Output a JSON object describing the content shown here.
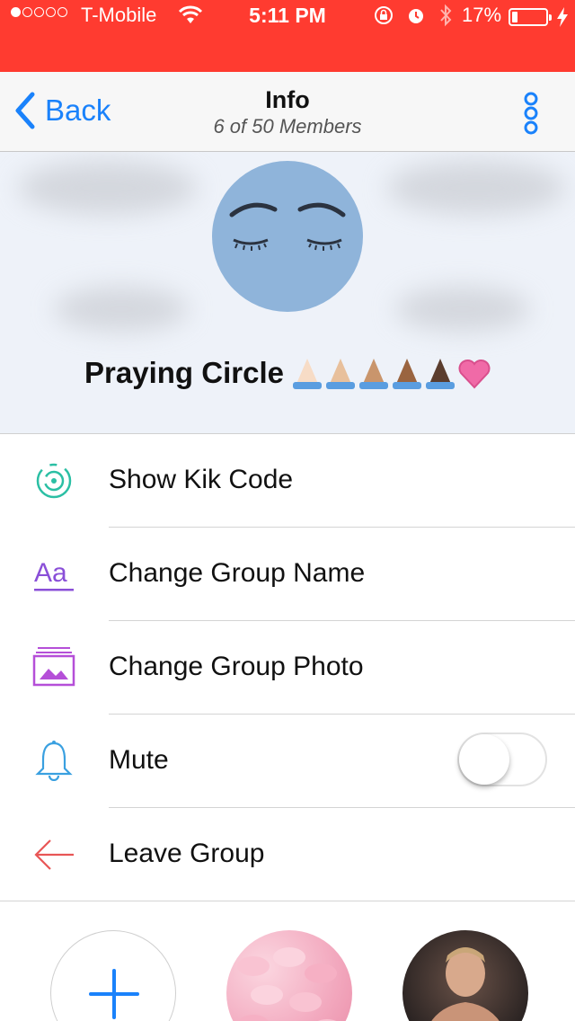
{
  "status_bar": {
    "carrier": "T-Mobile",
    "time": "5:11 PM",
    "battery": "17%",
    "battery_level": 0.17,
    "signal_bars": 1,
    "icons": [
      "wifi-icon",
      "rotation-lock-icon",
      "alarm-icon",
      "bluetooth-icon",
      "battery-icon",
      "charging-bolt-icon"
    ]
  },
  "nav": {
    "back_label": "Back",
    "title": "Info",
    "subtitle": "6 of 50 Members",
    "more_icon": "vertical-dots-icon"
  },
  "group": {
    "name": "Praying Circle",
    "emojis": [
      "🙏🏻",
      "🙏🏼",
      "🙏🏽",
      "🙏🏾",
      "🙏🏿",
      "💗"
    ]
  },
  "menu": [
    {
      "label": "Show Kik Code",
      "icon": "kik-code-icon",
      "color": "#2bbfa4"
    },
    {
      "label": "Change Group Name",
      "icon": "text-aa-icon",
      "color": "#8a4fd8"
    },
    {
      "label": "Change Group Photo",
      "icon": "photo-stack-icon",
      "color": "#b54fd8"
    },
    {
      "label": "Mute",
      "icon": "bell-icon",
      "color": "#3aa0e0",
      "toggle": false
    },
    {
      "label": "Leave Group",
      "icon": "arrow-left-icon",
      "color": "#e85656"
    }
  ],
  "colors": {
    "status_bar": "#ff3b30",
    "accent": "#1a82fb",
    "header_bg": "#eef2f9"
  }
}
